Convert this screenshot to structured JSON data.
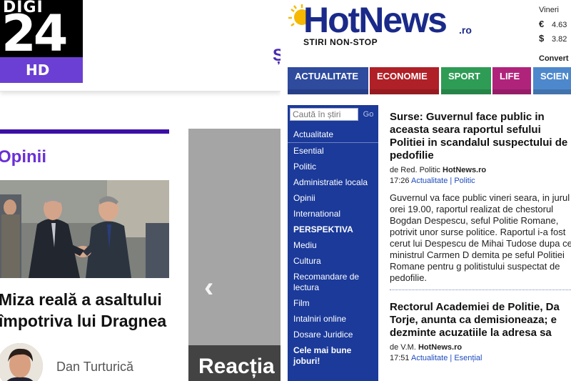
{
  "digi24": {
    "logo": {
      "word": "DIGI",
      "number": "24",
      "badge": "HD"
    },
    "menu_letter": "Ș",
    "section_title": "Opinii",
    "article": {
      "headline": "Miza reală a asaltului împotriva lui Dragnea",
      "author": "Dan Turturică"
    },
    "carousel": {
      "prev_arrow": "‹",
      "caption": "Reacția"
    }
  },
  "hotnews": {
    "logo": {
      "wordmark": "HotNews",
      "tld": ".ro",
      "tagline": "STIRI NON-STOP"
    },
    "fx": {
      "day": "Vineri",
      "rows": [
        {
          "symbol": "€",
          "value": "4.63"
        },
        {
          "symbol": "$",
          "value": "3.82"
        }
      ],
      "converter_label": "Convert"
    },
    "nav": [
      {
        "label": "ACTUALITATE",
        "color": "#2e4b9e"
      },
      {
        "label": "ECONOMIE",
        "color": "#b02027"
      },
      {
        "label": "SPORT",
        "color": "#2e9c55"
      },
      {
        "label": "LIFE",
        "color": "#b0237b"
      },
      {
        "label": "SCIEN",
        "color": "#4e88cc"
      }
    ],
    "search": {
      "placeholder": "Caută în știri",
      "button": "Go"
    },
    "sidebar": [
      {
        "label": "Actualitate",
        "bold": false
      },
      {
        "label": "Esential",
        "bold": false
      },
      {
        "label": "Politic",
        "bold": false
      },
      {
        "label": "Administratie locala",
        "bold": false
      },
      {
        "label": "Opinii",
        "bold": false
      },
      {
        "label": "International",
        "bold": false
      },
      {
        "label": "PERSPEKTIVA",
        "bold": true
      },
      {
        "label": "Mediu",
        "bold": false
      },
      {
        "label": "Cultura",
        "bold": false
      },
      {
        "label": "Recomandare de lectura",
        "bold": false
      },
      {
        "label": "Film",
        "bold": false
      },
      {
        "label": "Intalniri online",
        "bold": false
      },
      {
        "label": "Dosare Juridice",
        "bold": false
      },
      {
        "label": "Cele mai bune joburi!",
        "bold": true
      }
    ],
    "stories": [
      {
        "title": "Surse: Guvernul face public in aceasta seara raportul sefului Politiei in scandalul suspectului de pedofilie",
        "by_prefix": "de Red. Politic",
        "by_source": "HotNews.ro",
        "time": "17:26",
        "cat1": "Actualitate",
        "sep": "|",
        "cat2": "Politic",
        "body": "Guvernul va face public vineri seara, in jurul orei 19.00, raportul realizat de chestorul Bogdan Despescu, seful Politie Romane, potrivit unor surse politice. Raportul i-a fost cerut lui Despescu de Mihai Tudose dupa ce ministrul Carmen D demita pe seful Politiei Romane pentru g politistului suspectat de pedofilie."
      },
      {
        "title": "Rectorul Academiei de Politie, Da Torje, anunta ca demisioneaza; e dezminte acuzatiile la adresa sa",
        "by_prefix": "de V.M.",
        "by_source": "HotNews.ro",
        "time": "17:51",
        "cat1": "Actualitate",
        "sep": "|",
        "cat2": "Esențial"
      }
    ]
  }
}
